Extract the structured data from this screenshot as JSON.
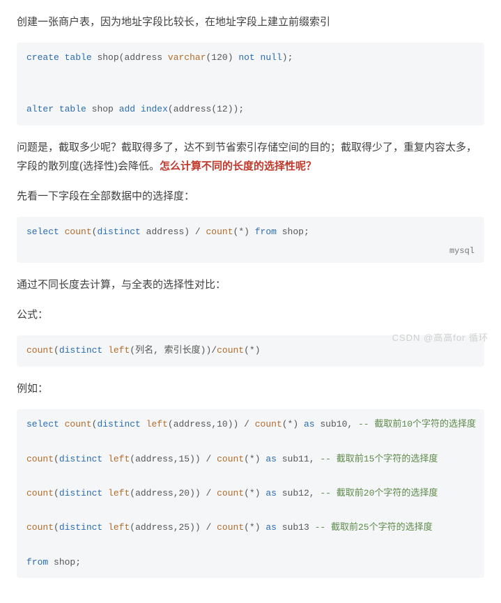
{
  "paragraphs": {
    "p1": "创建一张商户表，因为地址字段比较长，在地址字段上建立前缀索引",
    "p2_a": "问题是，截取多少呢？截取得多了，达不到节省索引存储空间的目的；截取得少了，重复内容太多，字段的散列度(选择性)会降低。",
    "p2_b": "怎么计算不同的长度的选择性呢？",
    "p3": "先看一下字段在全部数据中的选择度：",
    "p4": "通过不同长度去计算，与全表的选择性对比：",
    "p5": "公式：",
    "p6": "例如："
  },
  "code_block_1": {
    "line1": {
      "t1": "create",
      "t2": "table",
      "t3": "shop(address",
      "t4": "varchar",
      "t5": "(120)",
      "t6": "not",
      "t7": "null",
      "t8": ");"
    },
    "line2": {
      "t1": "alter",
      "t2": "table",
      "t3": "shop",
      "t4": "add",
      "t5": "index",
      "t6": "(address(12));"
    }
  },
  "code_block_2": {
    "line1": {
      "t1": "select",
      "t2": "count",
      "t3": "(",
      "t4": "distinct",
      "t5": " address) / ",
      "t6": "count",
      "t7": "(*) ",
      "t8": "from",
      "t9": " shop;"
    },
    "lang": "mysql"
  },
  "code_block_3": {
    "line1": {
      "t1": "count",
      "t2": "(",
      "t3": "distinct",
      "t4": " ",
      "t5": "left",
      "t6": "(列名, 索引长度))/",
      "t7": "count",
      "t8": "(*)"
    }
  },
  "code_block_4": {
    "line1": {
      "t1": "select",
      "t2": " ",
      "t3": "count",
      "t4": "(",
      "t5": "distinct",
      "t6": " ",
      "t7": "left",
      "t8": "(address,10)) / ",
      "t9": "count",
      "t10": "(*) ",
      "t11": "as",
      "t12": " sub10, ",
      "t13": "-- 截取前10个字符的选择度"
    },
    "line2": {
      "t1": "count",
      "t2": "(",
      "t3": "distinct",
      "t4": " ",
      "t5": "left",
      "t6": "(address,15)) / ",
      "t7": "count",
      "t8": "(*) ",
      "t9": "as",
      "t10": " sub11, ",
      "t11": "-- 截取前15个字符的选择度"
    },
    "line3": {
      "t1": "count",
      "t2": "(",
      "t3": "distinct",
      "t4": " ",
      "t5": "left",
      "t6": "(address,20)) / ",
      "t7": "count",
      "t8": "(*) ",
      "t9": "as",
      "t10": " sub12, ",
      "t11": "-- 截取前20个字符的选择度"
    },
    "line4": {
      "t1": "count",
      "t2": "(",
      "t3": "distinct",
      "t4": " ",
      "t5": "left",
      "t6": "(address,25)) / ",
      "t7": "count",
      "t8": "(*) ",
      "t9": "as",
      "t10": " sub13 ",
      "t11": "-- 截取前25个字符的选择度"
    },
    "line5": {
      "t1": "from",
      "t2": " shop;"
    }
  },
  "watermark": "CSDN @高高for 循环"
}
